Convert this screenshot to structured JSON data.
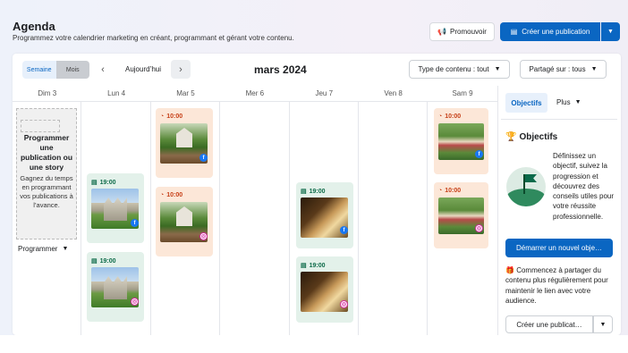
{
  "header": {
    "title": "Agenda",
    "subtitle": "Programmez votre calendrier marketing en créant, programmant et gérant votre contenu.",
    "promote_label": "Promouvoir",
    "create_label": "Créer une publication",
    "accent_color": "#0a66c2"
  },
  "toolbar": {
    "week_label": "Semaine",
    "month_label": "Mois",
    "today_label": "Aujourd’hui",
    "month_title": "mars 2024",
    "content_type_label": "Type de contenu : tout",
    "shared_on_label": "Partagé sur : tous"
  },
  "days": [
    "Dim 3",
    "Lun 4",
    "Mar 5",
    "Mer 6",
    "Jeu 7",
    "Ven 8",
    "Sam 9"
  ],
  "story": {
    "title": "Programmer une publication ou une story",
    "description": "Gagnez du temps en programmant vos publications à l’avance.",
    "button_label": "Programmer"
  },
  "posts": [
    {
      "day": "Lun 4",
      "time": "19:00",
      "status": "green",
      "image": "castle",
      "network": "facebook"
    },
    {
      "day": "Lun 4",
      "time": "19:00",
      "status": "green",
      "image": "castle",
      "network": "instagram"
    },
    {
      "day": "Mar 5",
      "time": "10:00",
      "status": "orange",
      "image": "garden",
      "network": "facebook"
    },
    {
      "day": "Mar 5",
      "time": "10:00",
      "status": "orange",
      "image": "garden",
      "network": "instagram"
    },
    {
      "day": "Jeu 7",
      "time": "19:00",
      "status": "green",
      "image": "book",
      "network": "facebook"
    },
    {
      "day": "Jeu 7",
      "time": "19:00",
      "status": "green",
      "image": "book",
      "network": "instagram"
    },
    {
      "day": "Sam 9",
      "time": "10:00",
      "status": "orange",
      "image": "kids",
      "network": "facebook"
    },
    {
      "day": "Sam 9",
      "time": "10:00",
      "status": "orange",
      "image": "kids",
      "network": "instagram"
    }
  ],
  "sidebar": {
    "tab_objectives": "Objectifs",
    "tab_more": "Plus",
    "objectives_heading": "Objectifs",
    "objectives_text": "Définissez un objectif, suivez la progression et découvrez des conseils utiles pour votre réussite professionnelle.",
    "start_button": "Démarrer un nouvel obje…",
    "share_text": "Commencez à partager du contenu plus régulièrement pour maintenir le lien avec votre audience.",
    "create_button": "Créer une publicat…"
  }
}
